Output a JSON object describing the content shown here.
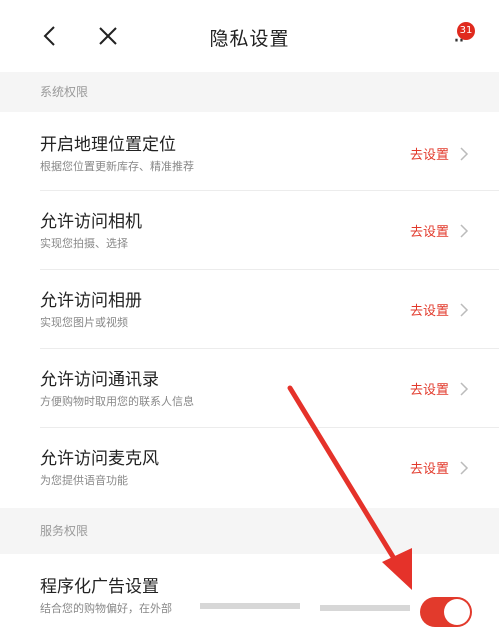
{
  "header": {
    "title": "隐私设置",
    "badge_count": "31",
    "more_label": "··"
  },
  "sections": {
    "system": "系统权限",
    "service": "服务权限"
  },
  "rows": [
    {
      "title": "开启地理位置定位",
      "subtitle": "根据您位置更新库存、精准推荐",
      "action": "去设置"
    },
    {
      "title": "允许访问相机",
      "subtitle": "实现您拍摄、选择",
      "action": "去设置"
    },
    {
      "title": "允许访问相册",
      "subtitle": "实现您图片或视频",
      "action": "去设置"
    },
    {
      "title": "允许访问通讯录",
      "subtitle": "方便购物时取用您的联系人信息",
      "action": "去设置"
    },
    {
      "title": "允许访问麦克风",
      "subtitle": "为您提供语音功能",
      "action": "去设置"
    }
  ],
  "ad_setting": {
    "title": "程序化广告设置",
    "subtitle": "结合您的购物偏好，在外部",
    "toggle_on": true
  },
  "colors": {
    "accent": "#e23a2c",
    "section_bg": "#f5f5f5"
  }
}
